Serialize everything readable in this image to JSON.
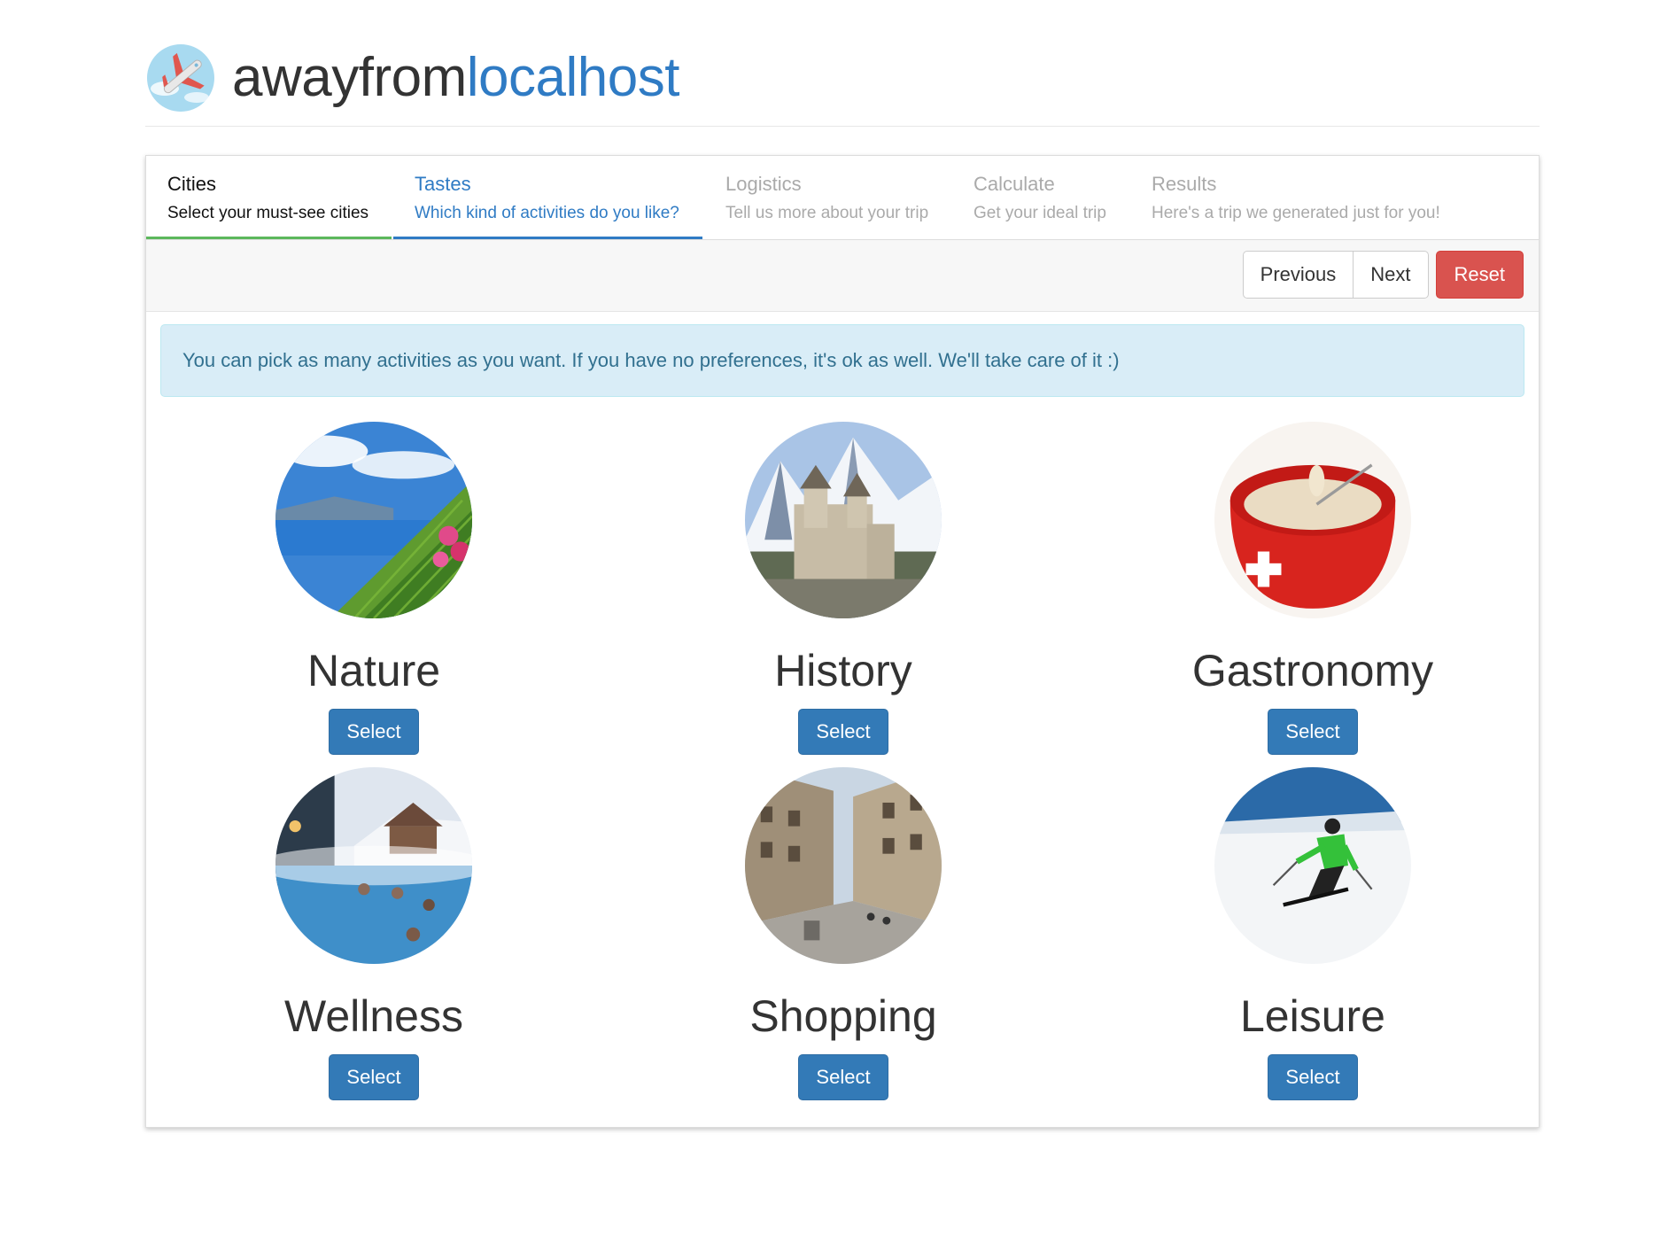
{
  "brand": {
    "name_part1": "awayfrom",
    "name_part2": "localhost"
  },
  "wizard": {
    "steps": [
      {
        "title": "Cities",
        "subtitle": "Select your must-see cities",
        "state": "done"
      },
      {
        "title": "Tastes",
        "subtitle": "Which kind of activities do you like?",
        "state": "active"
      },
      {
        "title": "Logistics",
        "subtitle": "Tell us more about your trip",
        "state": "todo"
      },
      {
        "title": "Calculate",
        "subtitle": "Get your ideal trip",
        "state": "todo"
      },
      {
        "title": "Results",
        "subtitle": "Here's a trip we generated just for you!",
        "state": "todo"
      }
    ],
    "buttons": {
      "previous": "Previous",
      "next": "Next",
      "reset": "Reset"
    },
    "info": "You can pick as many activities as you want. If you have no preferences, it's ok as well. We'll take care of it :)"
  },
  "activities": [
    {
      "name": "Nature",
      "button": "Select",
      "image": "vineyard-lake-photo"
    },
    {
      "name": "History",
      "button": "Select",
      "image": "castle-mountains-photo"
    },
    {
      "name": "Gastronomy",
      "button": "Select",
      "image": "fondue-pot-photo"
    },
    {
      "name": "Wellness",
      "button": "Select",
      "image": "thermal-pool-photo"
    },
    {
      "name": "Shopping",
      "button": "Select",
      "image": "city-street-photo"
    },
    {
      "name": "Leisure",
      "button": "Select",
      "image": "skier-photo"
    }
  ],
  "colors": {
    "primary": "#337ab7",
    "brand_blue": "#2f7bc4",
    "danger": "#d9534f",
    "success": "#5cb85c",
    "info_bg": "#d9edf7",
    "info_text": "#31708f"
  }
}
